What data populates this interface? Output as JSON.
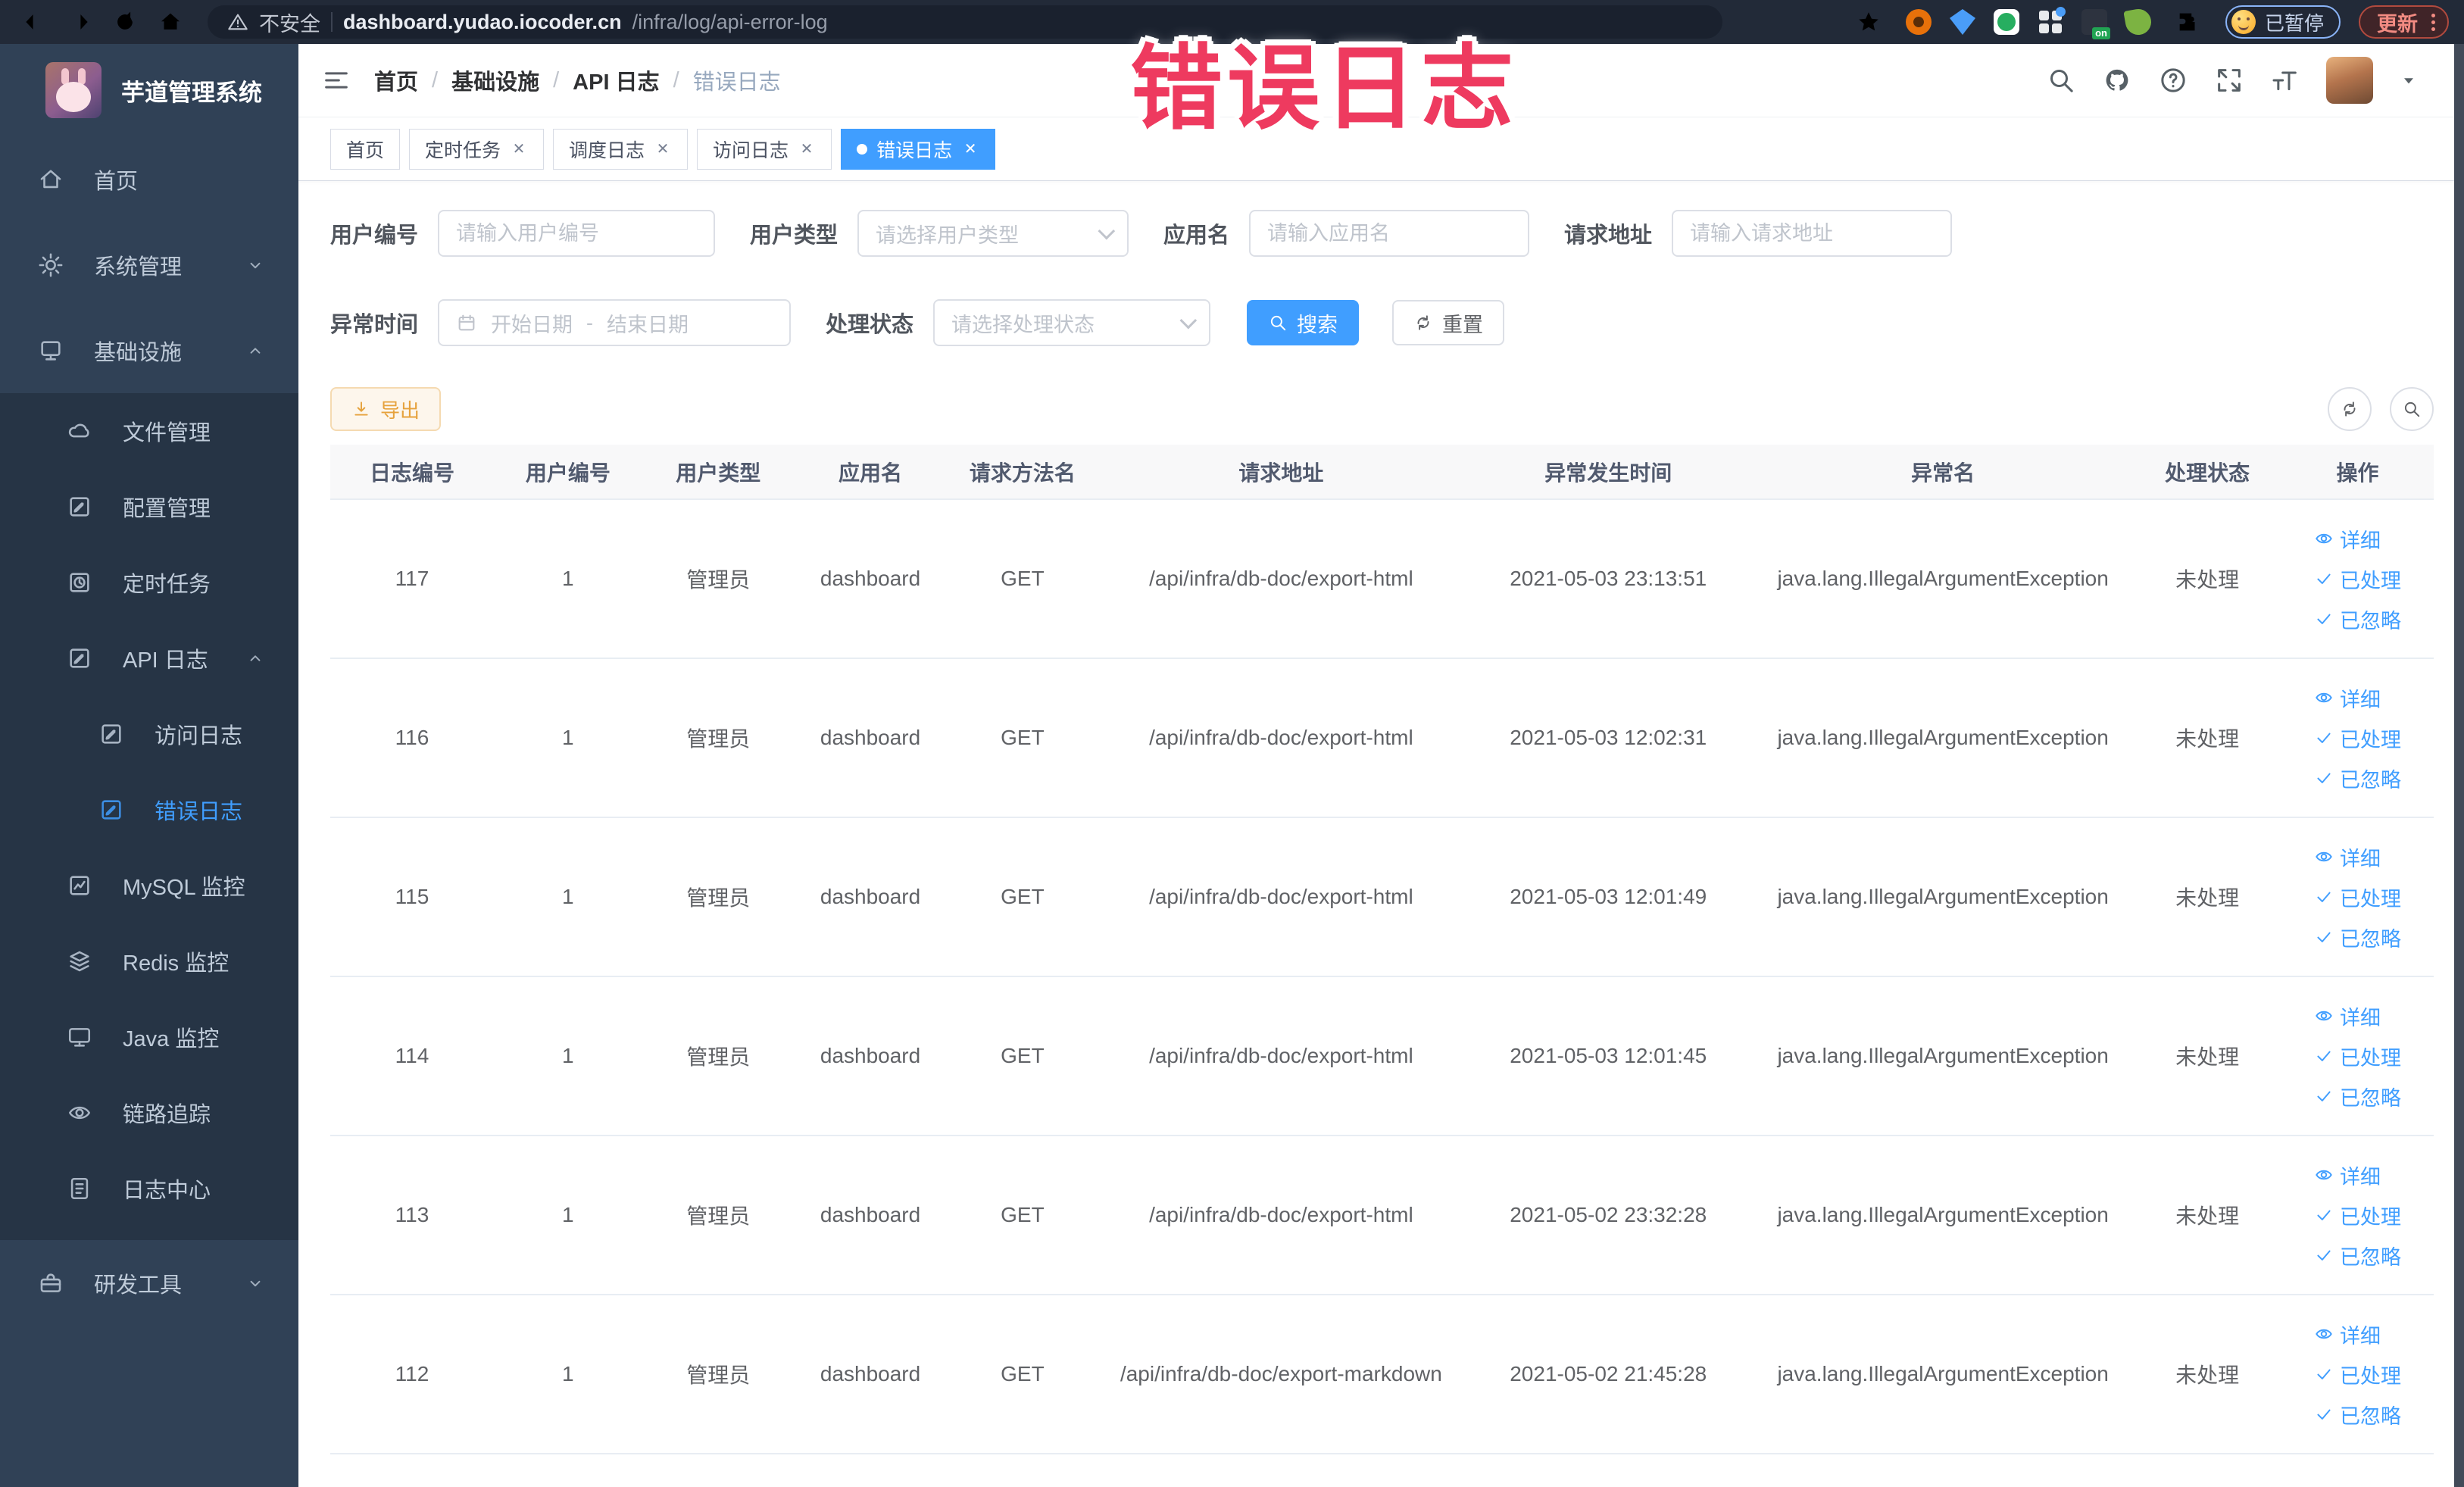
{
  "browser": {
    "security_label": "不安全",
    "url_host": "dashboard.yudao.iocoder.cn",
    "url_path": "/infra/log/api-error-log",
    "extension_badge": "on",
    "paused_badge": "已暂停",
    "update_button": "更新"
  },
  "annotation": {
    "text": "错误日志",
    "color": "#ee3a5f"
  },
  "sidebar": {
    "logo_title": "芋道管理系统",
    "items": [
      {
        "label": "首页"
      },
      {
        "label": "系统管理"
      },
      {
        "label": "基础设施"
      },
      {
        "label": "文件管理"
      },
      {
        "label": "配置管理"
      },
      {
        "label": "定时任务"
      },
      {
        "label": "API 日志"
      },
      {
        "label": "访问日志"
      },
      {
        "label": "错误日志"
      },
      {
        "label": "MySQL 监控"
      },
      {
        "label": "Redis 监控"
      },
      {
        "label": "Java 监控"
      },
      {
        "label": "链路追踪"
      },
      {
        "label": "日志中心"
      },
      {
        "label": "研发工具"
      }
    ]
  },
  "navbar": {
    "breadcrumb": [
      "首页",
      "基础设施",
      "API 日志",
      "错误日志"
    ],
    "breadcrumb_separator": "/"
  },
  "tabs": [
    {
      "label": "首页",
      "closable": false,
      "active": false
    },
    {
      "label": "定时任务",
      "closable": true,
      "active": false
    },
    {
      "label": "调度日志",
      "closable": true,
      "active": false
    },
    {
      "label": "访问日志",
      "closable": true,
      "active": false
    },
    {
      "label": "错误日志",
      "closable": true,
      "active": true
    }
  ],
  "filters": {
    "user_id": {
      "label": "用户编号",
      "placeholder": "请输入用户编号"
    },
    "user_type": {
      "label": "用户类型",
      "placeholder": "请选择用户类型"
    },
    "app_name": {
      "label": "应用名",
      "placeholder": "请输入应用名"
    },
    "request_url": {
      "label": "请求地址",
      "placeholder": "请输入请求地址"
    },
    "exception_time": {
      "label": "异常时间",
      "start_placeholder": "开始日期",
      "end_placeholder": "结束日期",
      "separator": "-"
    },
    "process_status": {
      "label": "处理状态",
      "placeholder": "请选择处理状态"
    },
    "search_button": "搜索",
    "reset_button": "重置"
  },
  "toolbar": {
    "export_button": "导出"
  },
  "table": {
    "columns": [
      "日志编号",
      "用户编号",
      "用户类型",
      "应用名",
      "请求方法名",
      "请求地址",
      "异常发生时间",
      "异常名",
      "处理状态",
      "操作"
    ],
    "actions": [
      "详细",
      "已处理",
      "已忽略"
    ],
    "rows": [
      {
        "log_id": "117",
        "user_id": "1",
        "user_type": "管理员",
        "app_name": "dashboard",
        "method": "GET",
        "url": "/api/infra/db-doc/export-html",
        "time": "2021-05-03 23:13:51",
        "exception": "java.lang.IllegalArgumentException",
        "status": "未处理"
      },
      {
        "log_id": "116",
        "user_id": "1",
        "user_type": "管理员",
        "app_name": "dashboard",
        "method": "GET",
        "url": "/api/infra/db-doc/export-html",
        "time": "2021-05-03 12:02:31",
        "exception": "java.lang.IllegalArgumentException",
        "status": "未处理"
      },
      {
        "log_id": "115",
        "user_id": "1",
        "user_type": "管理员",
        "app_name": "dashboard",
        "method": "GET",
        "url": "/api/infra/db-doc/export-html",
        "time": "2021-05-03 12:01:49",
        "exception": "java.lang.IllegalArgumentException",
        "status": "未处理"
      },
      {
        "log_id": "114",
        "user_id": "1",
        "user_type": "管理员",
        "app_name": "dashboard",
        "method": "GET",
        "url": "/api/infra/db-doc/export-html",
        "time": "2021-05-03 12:01:45",
        "exception": "java.lang.IllegalArgumentException",
        "status": "未处理"
      },
      {
        "log_id": "113",
        "user_id": "1",
        "user_type": "管理员",
        "app_name": "dashboard",
        "method": "GET",
        "url": "/api/infra/db-doc/export-html",
        "time": "2021-05-02 23:32:28",
        "exception": "java.lang.IllegalArgumentException",
        "status": "未处理"
      },
      {
        "log_id": "112",
        "user_id": "1",
        "user_type": "管理员",
        "app_name": "dashboard",
        "method": "GET",
        "url": "/api/infra/db-doc/export-markdown",
        "time": "2021-05-02 21:45:28",
        "exception": "java.lang.IllegalArgumentException",
        "status": "未处理"
      }
    ]
  },
  "colors": {
    "accent": "#409eff",
    "warning": "#e6a23c",
    "sidebar_bg": "#304156",
    "submenu_bg": "#263445",
    "annotation": "#ee3a5f"
  }
}
